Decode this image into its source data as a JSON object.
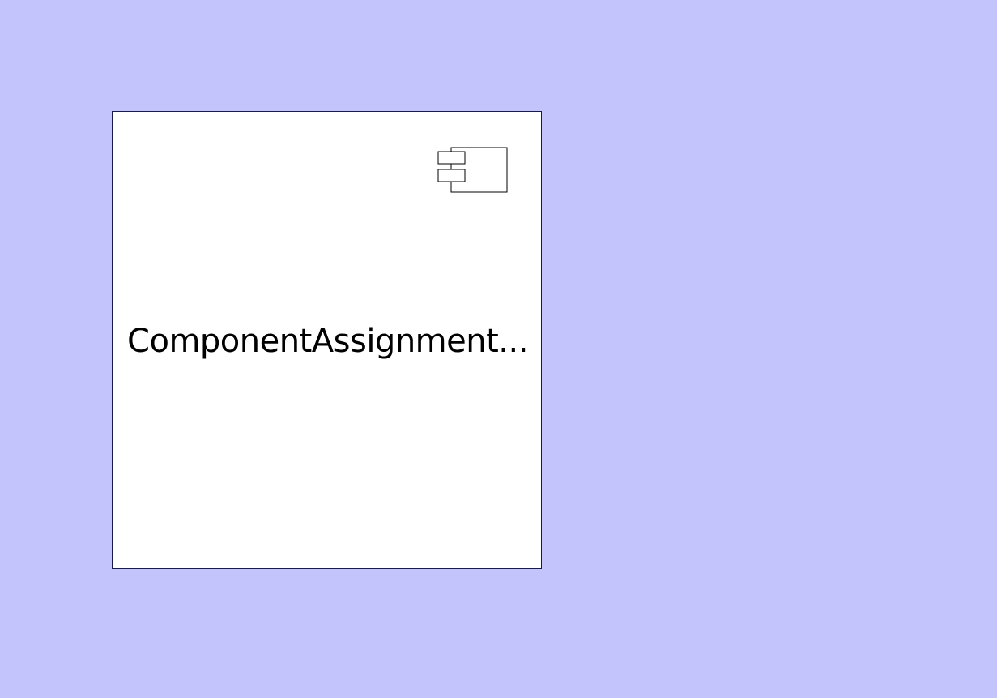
{
  "colors": {
    "canvas_background": "#c4c4fc",
    "component_fill": "#ffffff",
    "component_border": "#1a1a4a",
    "text": "#000000"
  },
  "component": {
    "label": "ComponentAssignment...",
    "icon": "uml-component-icon"
  }
}
